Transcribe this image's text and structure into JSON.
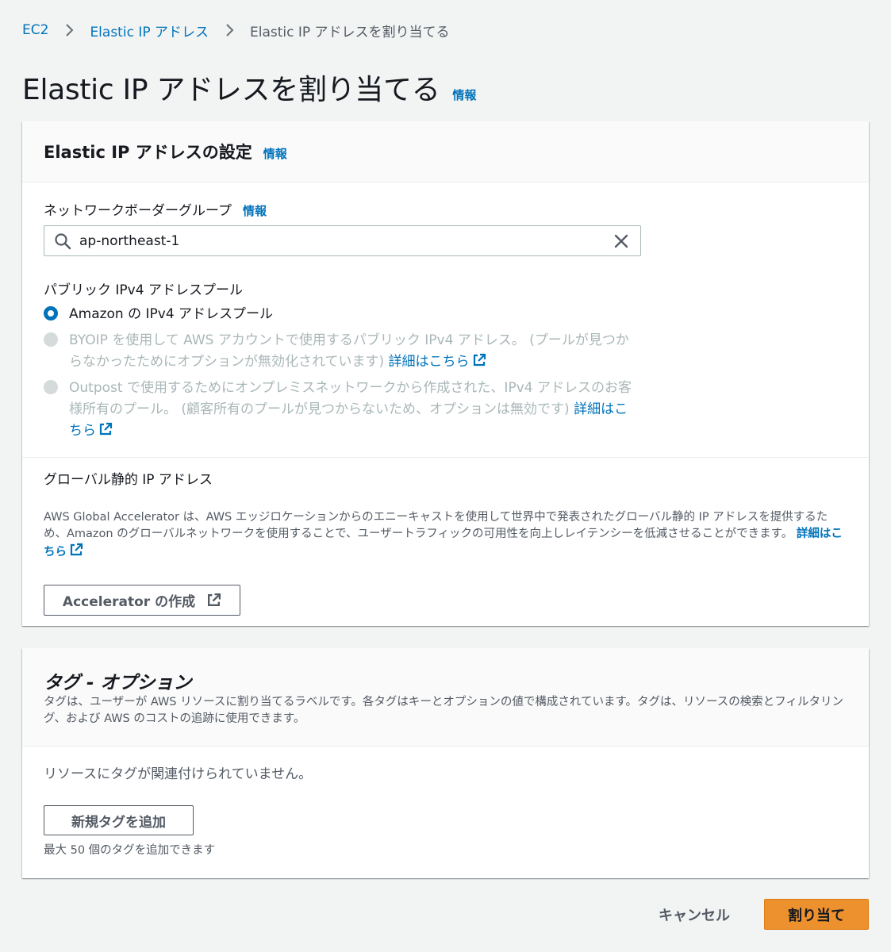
{
  "breadcrumb": {
    "items": [
      "EC2",
      "Elastic IP アドレス",
      "Elastic IP アドレスを割り当てる"
    ]
  },
  "page": {
    "title": "Elastic IP アドレスを割り当てる",
    "info": "情報"
  },
  "settings_panel": {
    "title": "Elastic IP アドレスの設定",
    "info": "情報",
    "network_border_group": {
      "label": "ネットワークボーダーグループ",
      "info": "情報",
      "value": "ap-northeast-1"
    },
    "public_pool": {
      "label": "パブリック IPv4 アドレスプール",
      "options": [
        {
          "text": "Amazon の IPv4 アドレスプール",
          "more": "",
          "selected": true,
          "disabled": false
        },
        {
          "text": "BYOIP を使用して AWS アカウントで使用するパブリック IPv4 アドレス。 (プールが見つからなかったためにオプションが無効化されています)",
          "more": "詳細はこちら",
          "selected": false,
          "disabled": true
        },
        {
          "text": "Outpost で使用するためにオンプレミスネットワークから作成された、IPv4 アドレスのお客様所有のプール。 (顧客所有のプールが見つからないため、オプションは無効です)",
          "more": "詳細はこちら",
          "selected": false,
          "disabled": true
        }
      ]
    },
    "global_static": {
      "label": "グローバル静的 IP アドレス",
      "description": "AWS Global Accelerator は、AWS エッジロケーションからのエニーキャストを使用して世界中で発表されたグローバル静的 IP アドレスを提供するため、Amazon のグローバルネットワークを使用することで、ユーザートラフィックの可用性を向上しレイテンシーを低減させることができます。",
      "more": "詳細はこちら",
      "button": "Accelerator の作成"
    }
  },
  "tags_panel": {
    "title": "タグ - オプション",
    "description": "タグは、ユーザーが AWS リソースに割り当てるラベルです。各タグはキーとオプションの値で構成されています。タグは、リソースの検索とフィルタリング、および AWS のコストの追跡に使用できます。",
    "empty": "リソースにタグが関連付けられていません。",
    "add_button": "新規タグを追加",
    "limit": "最大 50 個のタグを追加できます"
  },
  "footer": {
    "cancel": "キャンセル",
    "submit": "割り当て"
  },
  "colors": {
    "link": "#0073bb",
    "primary": "#ec912d",
    "background": "#f2f3f3",
    "disabled": "#aab7b8"
  }
}
